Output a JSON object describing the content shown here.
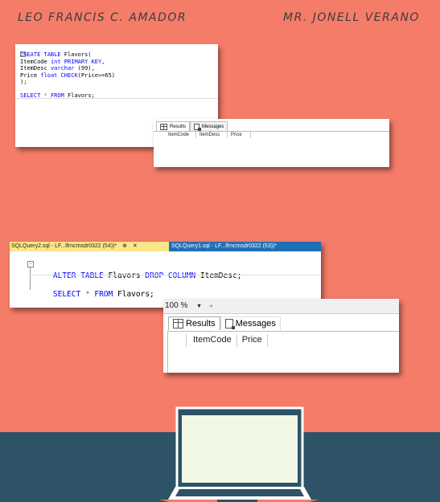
{
  "header": {
    "left_name": "LEO FRANCIS C. AMADOR",
    "right_name": "MR. JONELL VERANO"
  },
  "shot1": {
    "code_lines": [
      {
        "parts": [
          [
            "kw",
            "CREATE TABLE "
          ],
          [
            "",
            "Flavors("
          ]
        ]
      },
      {
        "parts": [
          [
            "",
            "ItemCode "
          ],
          [
            "kw",
            "int PRIMARY KEY"
          ],
          [
            "",
            ","
          ]
        ]
      },
      {
        "parts": [
          [
            "",
            "ItemDesc "
          ],
          [
            "kw",
            "varchar "
          ],
          [
            "",
            "(99),"
          ]
        ]
      },
      {
        "parts": [
          [
            "",
            "Price "
          ],
          [
            "kw",
            "float CHECK"
          ],
          [
            "",
            "(Price>=65)"
          ]
        ]
      },
      {
        "parts": [
          [
            "",
            ");"
          ]
        ]
      },
      {
        "parts": [
          [
            "",
            ""
          ]
        ]
      },
      {
        "parts": [
          [
            "kw",
            "SELECT "
          ],
          [
            "gray",
            "* "
          ],
          [
            "kw",
            "FROM "
          ],
          [
            "",
            "Flavors;"
          ]
        ]
      }
    ],
    "results_tab": "Results",
    "messages_tab": "Messages",
    "columns": [
      "ItemCode",
      "ItemDesc",
      "Price"
    ]
  },
  "shot2": {
    "tab1": "SQLQuery2.sql - LF...lfrncmsdr0322 (54))*",
    "tab2": "SQLQuery1.sql - LF...lfrncmsdr0322 (53))*",
    "pin_icon": "pin-icon",
    "close_icon": "close-icon",
    "line1_kw": "ALTER TABLE ",
    "line1_txt": "Flavors ",
    "line1_kw2": "DROP COLUMN ",
    "line1_end": "ItemDesc;",
    "line2_kw": "SELECT ",
    "line2_star": "* ",
    "line2_kw2": "FROM ",
    "line2_end": "Flavors;",
    "zoom": "100 %",
    "results_tab": "Results",
    "messages_tab": "Messages",
    "columns": [
      "ItemCode",
      "Price"
    ]
  },
  "colors": {
    "background": "#f57c69",
    "band": "#2e5266",
    "tab_active": "#fde68a",
    "tab_inactive": "#1f6fb5"
  }
}
